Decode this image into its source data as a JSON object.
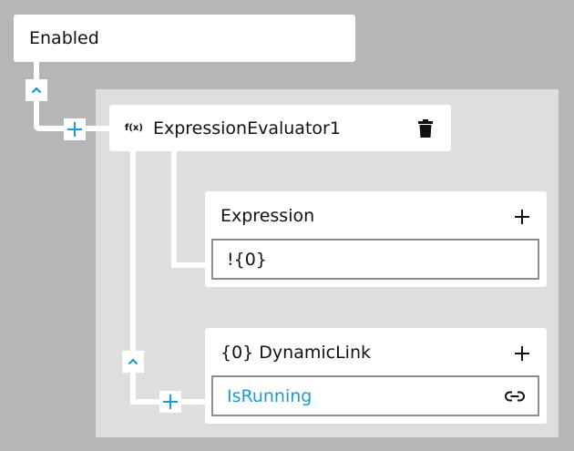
{
  "root": {
    "label": "Enabled"
  },
  "evaluator": {
    "label": "ExpressionEvaluator1",
    "fx_icon": "f(x)",
    "delete_icon": "trash-icon"
  },
  "expression": {
    "label": "Expression",
    "value": "!{0}",
    "add_icon": "plus-icon"
  },
  "dynamic_link": {
    "label": "{0} DynamicLink",
    "value": "IsRunning",
    "add_icon": "plus-icon",
    "link_icon": "link-icon"
  },
  "colors": {
    "background": "#b4b6b8",
    "panel": "#dcdee0",
    "accent": "#1c9ad6",
    "card": "#ffffff"
  }
}
